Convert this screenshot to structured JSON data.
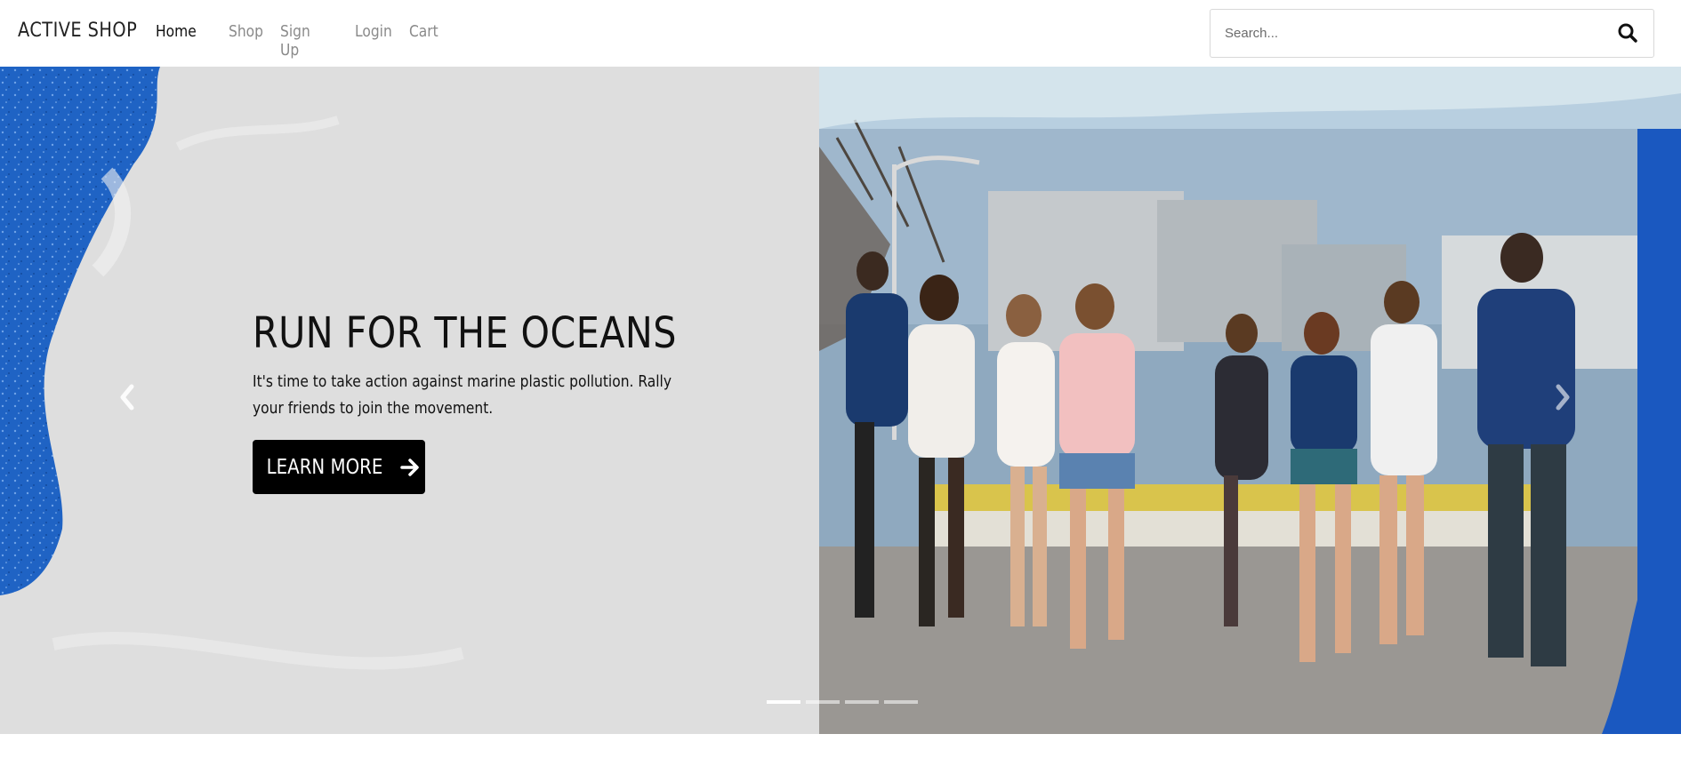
{
  "navbar": {
    "brand": "ACTIVE SHOP",
    "links": [
      {
        "label": "Home",
        "active": true
      },
      {
        "label": "Shop",
        "active": false
      },
      {
        "label": "Sign Up",
        "active": false
      },
      {
        "label": "Login",
        "active": false
      },
      {
        "label": "Cart",
        "active": false
      }
    ],
    "search": {
      "placeholder": "Search...",
      "value": "",
      "icon": "search-icon"
    }
  },
  "hero": {
    "title": "RUN FOR THE OCEANS",
    "text": "It's time to take action against marine plastic pollution. Rally your friends to join the movement.",
    "button": {
      "label": "LEARN MORE",
      "icon": "arrow-right-icon"
    },
    "prev_icon": "chevron-left-icon",
    "next_icon": "chevron-right-icon",
    "slides": 4,
    "active_slide": 1
  },
  "colors": {
    "blue_bg": "#1f63c4",
    "panel_gray": "#dedede",
    "button_black": "#000000"
  }
}
